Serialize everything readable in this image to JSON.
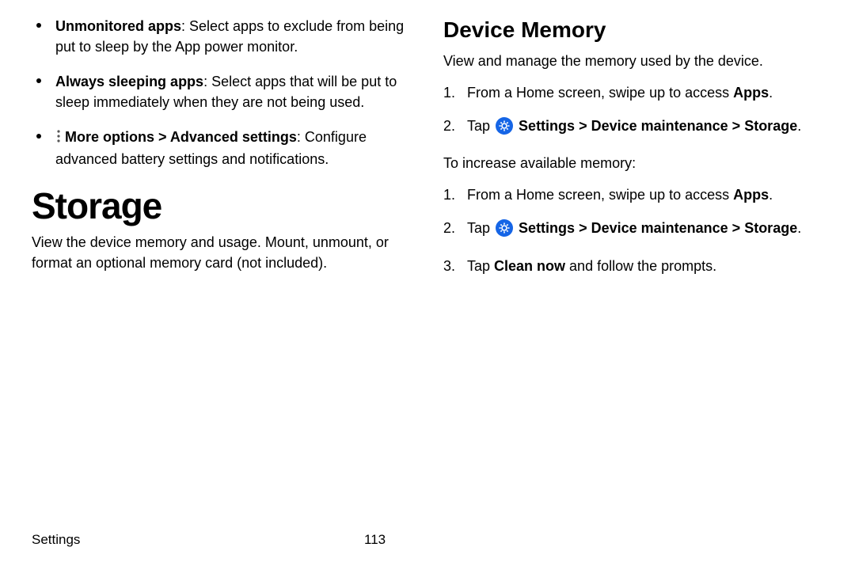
{
  "left": {
    "bullets": [
      {
        "label": "Unmonitored apps",
        "desc": ": Select apps to exclude from being put to sleep by the App power monitor."
      },
      {
        "label": "Always sleeping apps",
        "desc": ": Select apps that will be put to sleep immediately when they are not being used."
      }
    ],
    "more_bullet": {
      "label": "More options",
      "sep": " > ",
      "label2": "Advanced settings",
      "desc": ": Configure advanced battery settings and notifications."
    },
    "heading": "Storage",
    "body": "View the device memory and usage. Mount, unmount, or format an optional memory card (not included)."
  },
  "right": {
    "heading": "Device Memory",
    "intro": "View and manage the memory used by the device.",
    "steps1": {
      "s1_pre": "From a Home screen, swipe up to access ",
      "s1_bold": "Apps",
      "s1_post": ".",
      "s2_pre": "Tap ",
      "s2_settings": "Settings",
      "s2_sep": " > ",
      "s2_dm": "Device maintenance",
      "s2_storage": "Storage",
      "s2_post": "."
    },
    "mid": "To increase available memory:",
    "steps2": {
      "s1_pre": "From a Home screen, swipe up to access ",
      "s1_bold": "Apps",
      "s1_post": ".",
      "s2_pre": "Tap ",
      "s2_settings": "Settings",
      "s2_sep": " > ",
      "s2_dm": "Device maintenance",
      "s2_storage": "Storage",
      "s2_post": ".",
      "s3_pre": "Tap ",
      "s3_bold": "Clean now",
      "s3_post": " and follow the prompts."
    }
  },
  "footer": {
    "section": "Settings",
    "page": "113"
  }
}
